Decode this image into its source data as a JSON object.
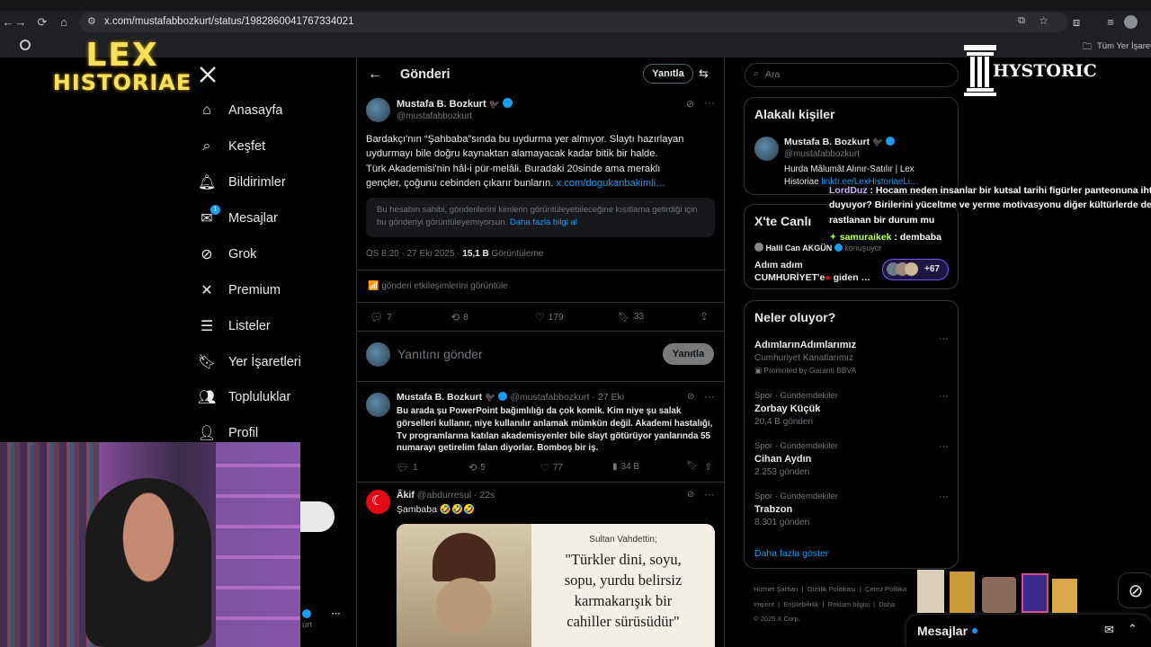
{
  "browser": {
    "url": "x.com/mustafabbozkurt/status/1982860041767334021",
    "bookmarks_label": "Tüm Yer İşaretle"
  },
  "overlays": {
    "lex_logo_line1": "LEX",
    "lex_logo_line2": "HISTORIAE",
    "hystoric_logo": "HYSTORIC"
  },
  "sidebar": {
    "items": [
      {
        "label": "Anasayfa",
        "icon": "home-icon"
      },
      {
        "label": "Keşfet",
        "icon": "search-icon"
      },
      {
        "label": "Bildirimler",
        "icon": "bell-icon"
      },
      {
        "label": "Mesajlar",
        "icon": "mail-icon",
        "badge": "1"
      },
      {
        "label": "Grok",
        "icon": "grok-icon"
      },
      {
        "label": "Premium",
        "icon": "x-logo-icon"
      },
      {
        "label": "Listeler",
        "icon": "list-icon"
      },
      {
        "label": "Yer İşaretleri",
        "icon": "bookmark-icon"
      },
      {
        "label": "Topluluklar",
        "icon": "communities-icon"
      },
      {
        "label": "Profil",
        "icon": "profile-icon"
      }
    ],
    "account_handle_fragment": "urt"
  },
  "header": {
    "title": "Gönderi",
    "reply_button": "Yanıtla"
  },
  "main_post": {
    "author": "Mustafa B. Bozkurt",
    "handle": "@mustafabbozkurt",
    "text_lines": [
      "Bardakçı'nın “Şahbaba”sında bu uydurma yer almıyor. Slaytı hazırlayan",
      "uydurmayı bile doğru kaynaktan alamayacak kadar bitik bir halde.",
      "Türk Akademisi'nin hâl-i pür-melâli. Buradaki 20sinde ama meraklı",
      "gençler, çoğunu cebinden çıkarır bunların."
    ],
    "link": "x.com/dogukanbakimli…",
    "restriction_text": "Bu hesabın sahibi, gönderilerini kimlerin görüntüleyebileceğine kısıtlama getirdiği için bu gönderiyi görüntüleyemiyorsun.",
    "restriction_link": "Daha fazla bilgi al",
    "timestamp": "ÖS 8:20 · 27 Eki 2025 · ",
    "views_count": "15,1 B",
    "views_label": " Görüntüleme",
    "engagements_label": "gönderi etkileşimlerini görüntüle",
    "actions": {
      "replies": "7",
      "reposts": "8",
      "likes": "179",
      "bookmarks": "33"
    }
  },
  "composer": {
    "placeholder": "Yanıtını gönder",
    "button": "Yanıtla"
  },
  "reply1": {
    "author": "Mustafa B. Bozkurt",
    "handle_time": "@mustafabbozkurt · 27 Eki",
    "text_lines": [
      "Bu arada şu PowerPoint bağımlılığı da çok komik. Kim niye şu salak",
      "görselleri kullanır, niye kullanılır anlamak mümkün değil. Akademi hastalığı,",
      "Tv programlarına katılan akademisyenler bile slayt götürüyor yanlarında 55",
      "numarayı getirelim falan diyorlar. Bomboş bir iş."
    ],
    "actions": {
      "replies": "1",
      "reposts": "5",
      "likes": "77",
      "views": "34 B"
    }
  },
  "reply2": {
    "author": "Âkif",
    "handle_time": "@abdurresul · 22s",
    "text": "Şambaba 🤣🤣🤣",
    "image_caption_small": "Sultan Vahdettin;",
    "image_quote_lines": [
      "\"Türkler dini, soyu,",
      "sopu, yurdu belirsiz",
      "karmakarışık bir",
      "cahiller sürüsüdür\""
    ]
  },
  "right": {
    "search_placeholder": "Ara",
    "related_title": "Alakalı kişiler",
    "related_name": "Mustafa B. Bozkurt",
    "related_handle": "@mustafabbozkurt",
    "related_bio": "Hurda Mâlumât Alınır-Satılır | Lex Historiae",
    "related_link": "linktr.ee/LexHistoriaeLi…",
    "live_title": "X'te Canlı",
    "live_host": "Halil Can AKGÜN",
    "live_host_status": "konuşuyor",
    "live_text_1": "Adım adım",
    "live_text_2": "CUMHURİYET'e",
    "live_text_3": " giden …",
    "live_count": "+67",
    "trends_title": "Neler oluyor?",
    "trends": [
      {
        "meta": "",
        "name": "AdımlarınAdımlarımız",
        "sub": "Cumhuriyet Kanatlarımız",
        "promoted": "Promoted by Garanti BBVA"
      },
      {
        "meta": "Spor · Gündemdekiler",
        "name": "Zorbay Küçük",
        "sub": "20,4 B gönderi"
      },
      {
        "meta": "Spor · Gündemdekiler",
        "name": "Cihan Aydın",
        "sub": "2.253 gönderi"
      },
      {
        "meta": "Spor · Gündemdekiler",
        "name": "Trabzon",
        "sub": "8.301 gönderi"
      }
    ],
    "show_more": "Daha fazla göster",
    "footer": [
      "Hizmet Şartları",
      "Gizlilik Politikası",
      "Çerez Politika",
      "Imprint",
      "Erişilebilirlik",
      "Reklam bilgisi",
      "Daha",
      "© 2025 X Corp."
    ]
  },
  "chat_overlay": {
    "user1": "LordDuz",
    "msg1_line1": " : Hocam neden insanlar bir kutsal tarihi figürler panteonuna ihti",
    "msg1_line2": "duyuyor? Birilerini yüceltme ve yerme motivasyonu diğer kültürlerde de",
    "msg1_line3": "rastlanan bir durum mu",
    "user2": "samuraikek",
    "msg2": " : dembaba"
  },
  "messages_drawer": {
    "title": "Mesajlar"
  },
  "colors": {
    "accent": "#1d9bf0",
    "logo_yellow": "#f7e15a",
    "chat_user1": "#c9b3ff",
    "chat_user2": "#b8ff5a"
  }
}
